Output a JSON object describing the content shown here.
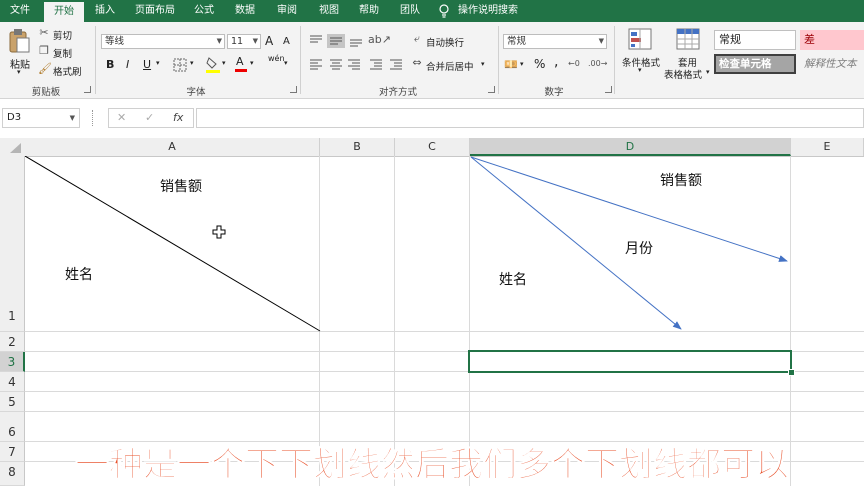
{
  "tabs": [
    "文件",
    "开始",
    "插入",
    "页面布局",
    "公式",
    "数据",
    "审阅",
    "视图",
    "帮助",
    "团队",
    "操作说明搜索"
  ],
  "clipboard": {
    "paste": "粘贴",
    "cut": "剪切",
    "copy": "复制",
    "format_painter": "格式刷",
    "group": "剪贴板"
  },
  "font": {
    "name": "等线",
    "size": "11",
    "grow": "A",
    "shrink": "A",
    "bold": "B",
    "italic": "I",
    "underline": "U",
    "font_color": "A",
    "phonetic": "wén",
    "group": "字体"
  },
  "alignment": {
    "wrap_text": "自动换行",
    "merge_center": "合并后居中",
    "group": "对齐方式"
  },
  "number": {
    "format": "常规",
    "percent": "%",
    "comma": ",",
    "group": "数字"
  },
  "styles": {
    "conditional": "条件格式",
    "table_format_1": "套用",
    "table_format_2": "表格格式",
    "normal": "常规",
    "bad": "差",
    "check_cell": "检查单元格",
    "explanatory": "解释性文本"
  },
  "name_box": "D3",
  "formula_icons": {
    "cancel": "✕",
    "enter": "✓",
    "fx": "fx"
  },
  "columns": [
    "A",
    "B",
    "C",
    "D",
    "E"
  ],
  "rows": [
    "1",
    "2",
    "3",
    "4",
    "5",
    "6",
    "7",
    "8"
  ],
  "cells": {
    "a1_top": "销售额",
    "a1_bottom": "姓名",
    "d1_top": "销售额",
    "d1_mid": "月份",
    "d1_bottom": "姓名"
  },
  "subtitle": "一种是一个下下划线然后我们多个下划线都可以",
  "colors": {
    "accent": "#217346",
    "arrow": "#4472c4",
    "subtitle": "#e8502a",
    "bad_fill": "#ffc7ce",
    "bad_text": "#9c0006"
  }
}
